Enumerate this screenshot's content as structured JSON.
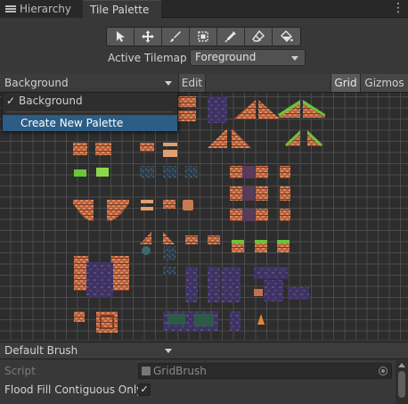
{
  "tabs": {
    "hierarchy": "Hierarchy",
    "tile_palette": "Tile Palette"
  },
  "toolbar": {
    "tools": [
      "select-icon",
      "move-icon",
      "paintbrush-icon",
      "box-fill-icon",
      "picker-icon",
      "eraser-icon",
      "fill-bucket-icon"
    ]
  },
  "active_tilemap": {
    "label": "Active Tilemap",
    "value": "Foreground"
  },
  "palette_bar": {
    "palette": "Background",
    "edit": "Edit",
    "grid": "Grid",
    "gizmos": "Gizmos"
  },
  "palette_dropdown": {
    "checked_item": "Background",
    "create_item": "Create New Palette"
  },
  "brush": {
    "selected": "Default Brush"
  },
  "inspector": {
    "script_label": "Script",
    "script_value": "GridBrush",
    "flood_fill_label": "Flood Fill Contiguous Only",
    "flood_fill_checked": "✓"
  },
  "colors": {
    "panel_bg": "#383838",
    "grid_line": "#4a4a4a",
    "highlight": "#2c5d87",
    "brick_orange": "#c8704a",
    "purple_wall": "#4a3a6a",
    "grass_green": "#6ec23a"
  }
}
